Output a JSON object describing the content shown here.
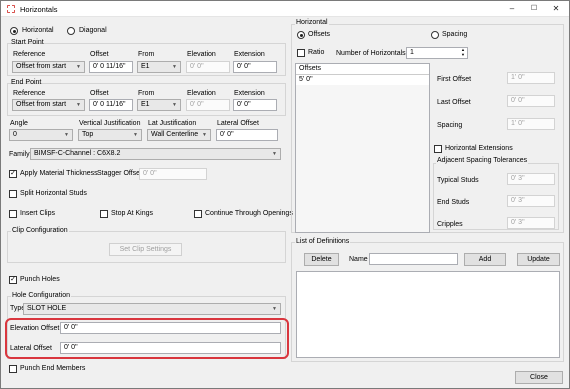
{
  "window": {
    "title": "Horizontals"
  },
  "mode": {
    "horizontal": "Horizontal",
    "diagonal": "Diagonal"
  },
  "start": {
    "title": "Start Point",
    "ref_label": "Reference",
    "offset_label": "Offset",
    "from_label": "From",
    "elev_label": "Elevation",
    "ext_label": "Extension",
    "reference": "Offset from start",
    "offset": "0'  0 11/16\"",
    "from": "E1",
    "elevation": "0'  0\"",
    "extension": "0'  0\""
  },
  "end": {
    "title": "End Point",
    "ref_label": "Reference",
    "offset_label": "Offset",
    "from_label": "From",
    "elev_label": "Elevation",
    "ext_label": "Extension",
    "reference": "Offset from start",
    "offset": "0'  0 11/16\"",
    "from": "E1",
    "elevation": "0'  0\"",
    "extension": "0'  0\""
  },
  "angle": {
    "label": "Angle",
    "value": "0"
  },
  "vjust": {
    "label": "Vertical Justification",
    "value": "Top"
  },
  "ljust": {
    "label": "Lat Justification",
    "value": "Wall Centerline"
  },
  "latoff": {
    "label": "Lateral Offset",
    "value": "0'  0\""
  },
  "family": {
    "label": "Family",
    "value": "BIMSF-C-Channel : C6X8.2"
  },
  "material": {
    "label": "Apply Material Thickness",
    "stagger_label": "Stagger Offset:",
    "stagger_value": "0'  0\""
  },
  "split": {
    "label": "Split Horizontal Studs"
  },
  "clips": {
    "insert": "Insert Clips",
    "stop": "Stop At Kings",
    "continue": "Continue Through Openings"
  },
  "clipcfg": {
    "title": "Clip Configuration",
    "button": "Set Clip Settings"
  },
  "punch": {
    "label": "Punch Holes"
  },
  "holecfg": {
    "title": "Hole Configuration",
    "type_label": "Type",
    "type_value": "SLOT HOLE",
    "elev_label": "Elevation Offset",
    "elev_value": "0'  0\"",
    "lat_label": "Lateral Offset",
    "lat_value": "0'  0\""
  },
  "punchend": {
    "label": "Punch End Members"
  },
  "horizontal": {
    "title": "Horizontal",
    "offsets": "Offsets",
    "spacing": "Spacing",
    "ratio": "Ratio",
    "num_label": "Number of Horizontals",
    "num_value": "1",
    "list_header": "Offsets",
    "list_items": [
      "5'  0\""
    ],
    "first_label": "First Offset",
    "first_value": "1'  0\"",
    "last_label": "Last Offset",
    "last_value": "0'  0\"",
    "spacing_label": "Spacing",
    "spacing_value": "1'  0\"",
    "extensions": "Horizontal Extensions"
  },
  "adj": {
    "title": "Adjacent Spacing Tolerances",
    "typical_label": "Typical Studs",
    "typical_value": "0'  3\"",
    "end_label": "End Studs",
    "end_value": "0'  3\"",
    "cripples_label": "Cripples",
    "cripples_value": "0'  3\""
  },
  "defs": {
    "title": "List of Definitions",
    "delete": "Delete",
    "name_label": "Name",
    "name_value": "",
    "add": "Add",
    "update": "Update"
  },
  "footer": {
    "close": "Close"
  },
  "colors": {
    "highlight": "#d9363e",
    "accent_icon": "#d9534f"
  }
}
